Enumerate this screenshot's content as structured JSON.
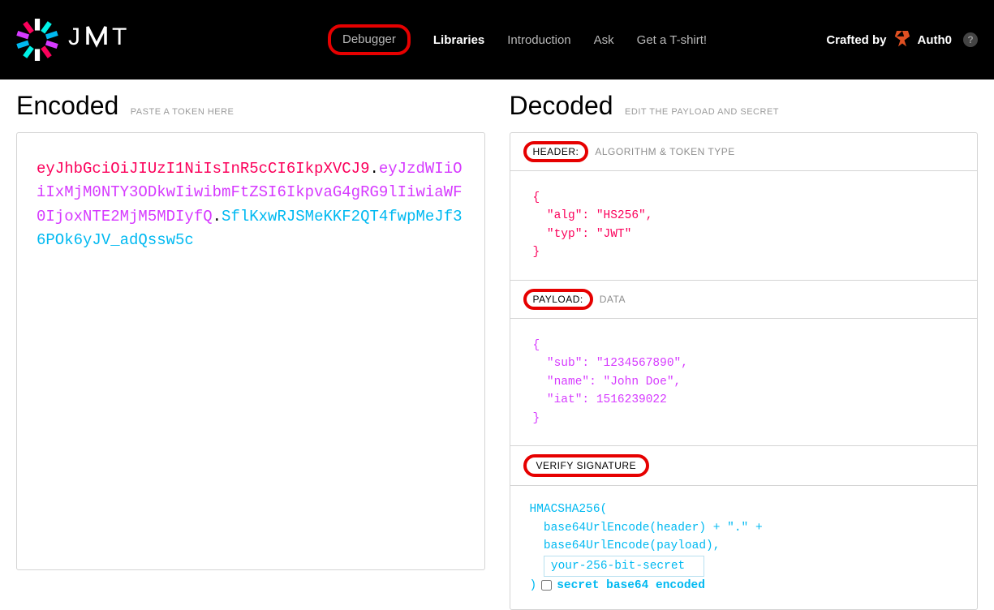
{
  "brand": "JWT",
  "nav": {
    "items": [
      "Debugger",
      "Libraries",
      "Introduction",
      "Ask",
      "Get a T-shirt!"
    ]
  },
  "crafted": {
    "label": "Crafted by",
    "company": "Auth0"
  },
  "encoded": {
    "title": "Encoded",
    "sub": "PASTE A TOKEN HERE",
    "token_header": "eyJhbGciOiJIUzI1NiIsInR5cCI6IkpXVCJ9",
    "token_payload": "eyJzdWIiOiIxMjM0NTY3ODkwIiwibmFtZSI6IkpvaG4gRG9lIiwiaWF0IjoxNTE2MjM5MDIyfQ",
    "token_sig": "SflKxwRJSMeKKF2QT4fwpMeJf36POk6yJV_adQssw5c"
  },
  "decoded": {
    "title": "Decoded",
    "sub": "EDIT THE PAYLOAD AND SECRET",
    "header_label": "HEADER:",
    "header_sub": "ALGORITHM & TOKEN TYPE",
    "header_json": "{\n  \"alg\": \"HS256\",\n  \"typ\": \"JWT\"\n}",
    "payload_label": "PAYLOAD:",
    "payload_sub": "DATA",
    "payload_json": "{\n  \"sub\": \"1234567890\",\n  \"name\": \"John Doe\",\n  \"iat\": 1516239022\n}",
    "signature_label": "VERIFY SIGNATURE",
    "sig_line1": "HMACSHA256(",
    "sig_line2": "  base64UrlEncode(header) + \".\" +",
    "sig_line3": "  base64UrlEncode(payload),",
    "secret_value": "your-256-bit-secret",
    "sig_close": ")",
    "sig_checkbox_label": "secret base64 encoded"
  }
}
